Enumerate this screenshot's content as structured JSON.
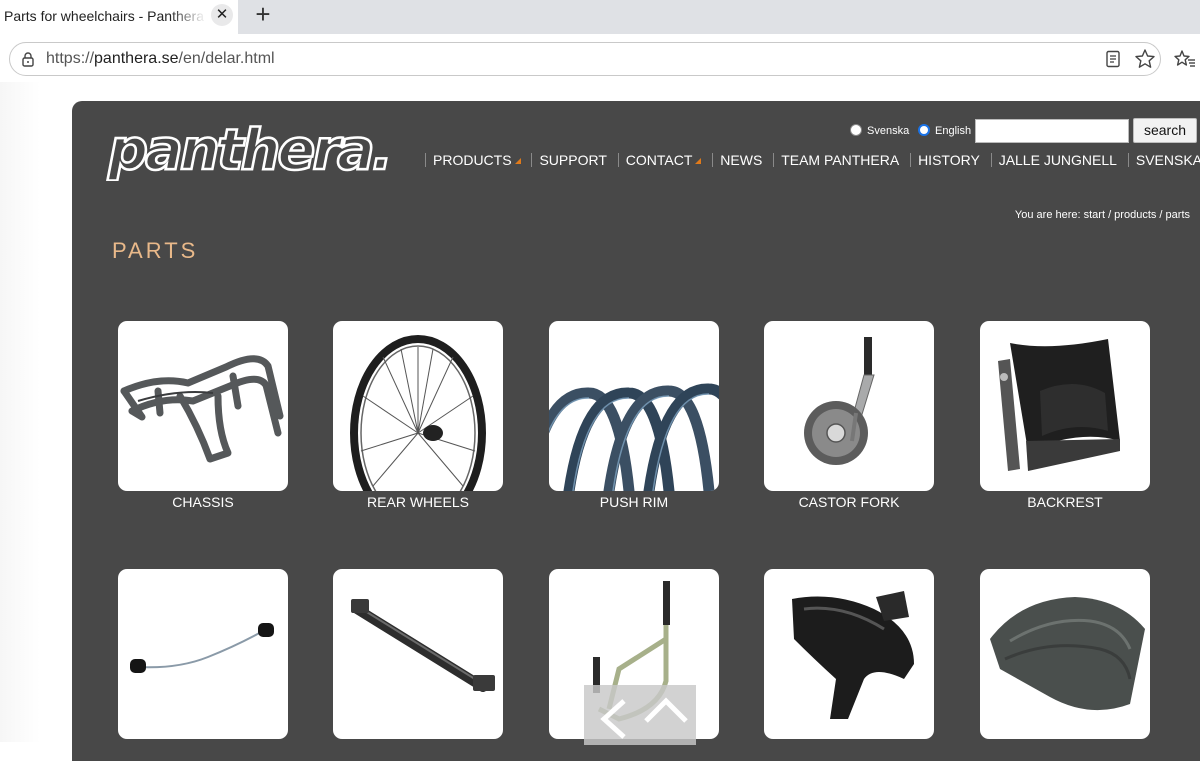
{
  "browser": {
    "tab_title": "Parts for wheelchairs - Panthera AB",
    "url_prefix": "https://",
    "url_host": "panthera.se",
    "url_path": "/en/delar.html"
  },
  "site": {
    "logo_text": "panthera.",
    "language": {
      "options": [
        "Svenska",
        "English"
      ],
      "selected": "English"
    },
    "search": {
      "button_label": "search",
      "value": ""
    },
    "nav": [
      {
        "label": "PRODUCTS",
        "has_submenu": true
      },
      {
        "label": "SUPPORT",
        "has_submenu": false
      },
      {
        "label": "CONTACT",
        "has_submenu": true
      },
      {
        "label": "NEWS",
        "has_submenu": false
      },
      {
        "label": "TEAM PANTHERA",
        "has_submenu": false
      },
      {
        "label": "HISTORY",
        "has_submenu": false
      },
      {
        "label": "JALLE JUNGNELL",
        "has_submenu": false
      },
      {
        "label": "SVENSKA",
        "has_submenu": true
      }
    ],
    "breadcrumb": "You are here: start / products / parts",
    "page_title": "PARTS",
    "parts": [
      {
        "label": "CHASSIS",
        "icon": "chassis-icon"
      },
      {
        "label": "REAR WHEELS",
        "icon": "rear-wheel-icon"
      },
      {
        "label": "PUSH RIM",
        "icon": "push-rim-icon"
      },
      {
        "label": "CASTOR FORK",
        "icon": "castor-fork-icon"
      },
      {
        "label": "BACKREST",
        "icon": "backrest-icon"
      },
      {
        "label": "",
        "icon": "cable-icon"
      },
      {
        "label": "",
        "icon": "axle-bar-icon"
      },
      {
        "label": "",
        "icon": "footrest-frame-icon"
      },
      {
        "label": "",
        "icon": "side-guard-icon"
      },
      {
        "label": "",
        "icon": "seat-cushion-icon"
      }
    ],
    "colors": {
      "background": "#484848",
      "title": "#e9b98a",
      "accent": "#e07a1a"
    }
  }
}
